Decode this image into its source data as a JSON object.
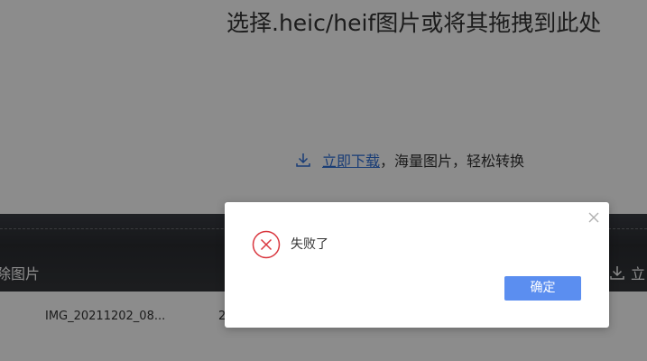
{
  "upload": {
    "title": "选择.heic/heif图片或将其拖拽到此处",
    "download_link": "立即下载",
    "download_suffix": "，海量图片，轻松转换"
  },
  "toolbar": {
    "left_label": "除图片",
    "right_label": "立"
  },
  "file_row": {
    "name": "IMG_20211202_08...",
    "extra": "2"
  },
  "dialog": {
    "message": "失败了",
    "confirm_label": "确定",
    "icon": "error-circle-x-icon",
    "accent": "#5b8ef0",
    "error_color": "#d9363e"
  }
}
